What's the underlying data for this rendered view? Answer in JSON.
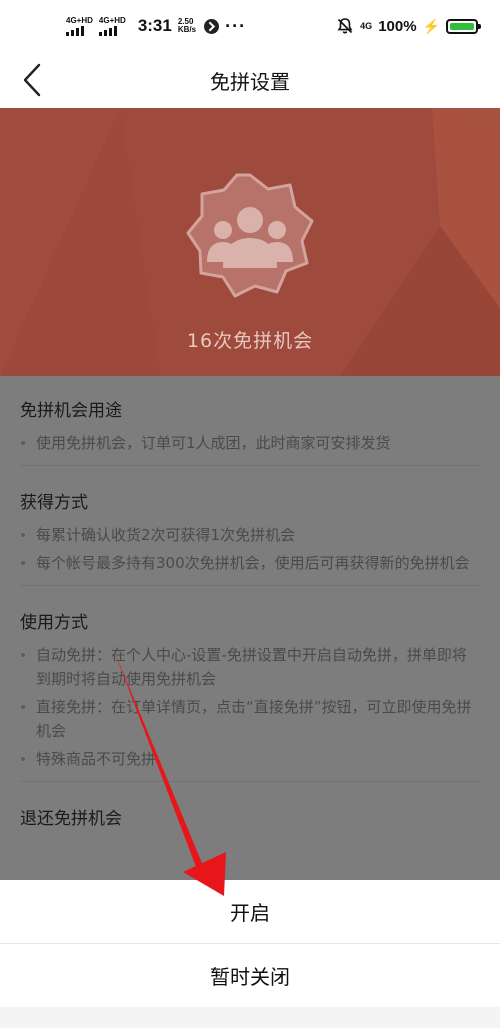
{
  "status_bar": {
    "network_1": "4G+HD",
    "network_2": "4G+HD",
    "time": "3:31",
    "speed_value": "2.50",
    "speed_unit": "KB/s",
    "more": "···",
    "network_right": "4G",
    "battery_percent": "100%",
    "battery_level": 1.0,
    "battery_color": "#2fbf3a"
  },
  "nav": {
    "title": "免拼设置"
  },
  "hero": {
    "chances_text": "16次免拼机会",
    "background_color": "#9e4a3d"
  },
  "sections": [
    {
      "title": "免拼机会用途",
      "items": [
        "使用免拼机会，订单可1人成团，此时商家可安排发货"
      ]
    },
    {
      "title": "获得方式",
      "items": [
        "每累计确认收货2次可获得1次免拼机会",
        "每个帐号最多持有300次免拼机会，使用后可再获得新的免拼机会"
      ]
    },
    {
      "title": "使用方式",
      "items": [
        "自动免拼：在个人中心-设置-免拼设置中开启自动免拼，拼单即将到期时将自动使用免拼机会",
        "直接免拼：在订单详情页，点击“直接免拼”按钮，可立即使用免拼机会",
        "特殊商品不可免拼"
      ]
    },
    {
      "title": "退还免拼机会",
      "items": []
    }
  ],
  "sheet": {
    "enable_label": "开启",
    "disable_label": "暂时关闭"
  },
  "annotation": {
    "arrow_color": "#e8151b"
  }
}
